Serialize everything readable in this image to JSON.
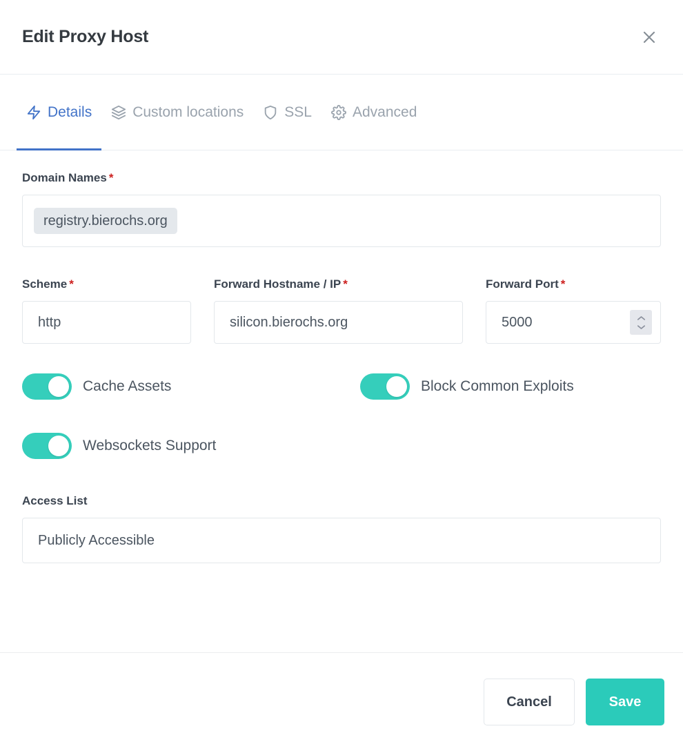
{
  "header": {
    "title": "Edit Proxy Host",
    "close_icon": "close-icon"
  },
  "tabs": [
    {
      "label": "Details",
      "icon": "zap-icon",
      "active": true
    },
    {
      "label": "Custom locations",
      "icon": "layers-icon",
      "active": false
    },
    {
      "label": "SSL",
      "icon": "shield-icon",
      "active": false
    },
    {
      "label": "Advanced",
      "icon": "gear-icon",
      "active": false
    }
  ],
  "form": {
    "domain_names": {
      "label": "Domain Names",
      "required_marker": "*",
      "tags": [
        "registry.bierochs.org"
      ]
    },
    "scheme": {
      "label": "Scheme",
      "required_marker": "*",
      "value": "http"
    },
    "forward_hostname": {
      "label": "Forward Hostname / IP",
      "required_marker": "*",
      "value": "silicon.bierochs.org"
    },
    "forward_port": {
      "label": "Forward Port",
      "required_marker": "*",
      "value": "5000",
      "spinner_icon": "chevron-up-down-icon"
    },
    "toggles": [
      {
        "label": "Cache Assets",
        "on": true
      },
      {
        "label": "Block Common Exploits",
        "on": true
      },
      {
        "label": "Websockets Support",
        "on": true
      }
    ],
    "access_list": {
      "label": "Access List",
      "value": "Publicly Accessible"
    }
  },
  "footer": {
    "cancel_label": "Cancel",
    "save_label": "Save"
  },
  "colors": {
    "accent_teal": "#2bcbba",
    "accent_blue": "#4273c8",
    "required_red": "#cd201f",
    "text_dark": "#343a40",
    "text_muted": "#9aa3ad"
  }
}
